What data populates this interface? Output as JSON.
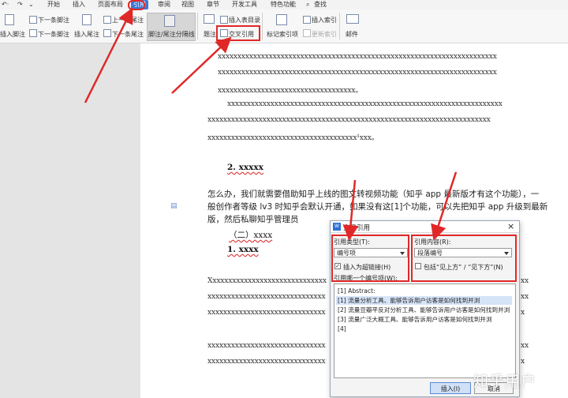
{
  "menubar": {
    "items": [
      "开始",
      "插入",
      "页面布局",
      "引用",
      "审阅",
      "视图",
      "章节",
      "开发工具",
      "特色功能"
    ],
    "search_label": "查找"
  },
  "ribbon": {
    "insert_footnote": "插入脚注",
    "next_footnote": "下一条脚注",
    "prev_footnote": "上一条脚注",
    "insert_endnote": "插入尾注",
    "prev_endnote": "上一条尾注",
    "next_endnote": "下一条尾注",
    "separator": "脚注/尾注分隔线",
    "caption": "题注",
    "insert_toc": "插入表目录",
    "cross_ref": "交叉引用",
    "mark_index": "标记索引项",
    "insert_index": "插入索引",
    "update_index": "更新索引",
    "mail": "邮件"
  },
  "document": {
    "para1": [
      "xxxxxxxxxxxxxxxxxxxxxxxxxxxxxxxxxxxxxxxxxxxxxxxxxxxxxxxxxxxxxxxxxxxxxxx",
      "xxxxxxxxxxxxxxxxxxxxxxxxxxxxxxxxxxxxxxxxxxxxxxxxxxxxxxxxxxxxxxxxxxxxxxx",
      "xxxxxxxxxxxxxxxxxxxxxxxxxxxxxxxxxxx。"
    ],
    "para2": [
      "xxxxxxxxxxxxxxxxxxxxxxxxxxxxxxxxxxxxxxxxxxxxxxxxxxxxxxxxxxxxxxxxxxxxxx",
      "xxxxxxxxxxxxxxxxxxxxxxxxxxxxxxxxxxxxxxxxxxxxxxxxxxxxxxxxxxxxxxxxxxxxxxxx",
      "xxxxxxxxxxxxxxxxxxxxxxxxxxxxxxxxxxxxxx¹xxx。"
    ],
    "heading2": "2. xxxxx",
    "zh_lines": [
      "怎么办，我们就需要借助知乎上线的图文转视频功能（知乎 app 最新版才有这个功能），一",
      "般创作者等级 lv3 时知乎会默认开通，如果没有这[1]个功能，可以先把知乎 app 升级到最新",
      "版，然后私聊知乎管理员"
    ],
    "subheading": "（二）xxxx",
    "heading1": "1. xxxx",
    "para3": [
      "Xxxxxxxxxxxxxxxxxxxxxxxxxxxxxx",
      "xxxxxxxxxxxxxxxxxxxxxxxxxxxxxx",
      "xxxxxxxxxxxxxxxxxxxxxxxxxxxxxx"
    ],
    "para4": [
      "xxxxxxxxxxxxxxxxxxxxxxxxxxxxxx",
      "xxxxxxxxxxxxxxxxxxxxxxxxxxxxxx"
    ],
    "right_tail": [
      "xx",
      "xx",
      "x",
      "xx",
      "x"
    ]
  },
  "dialog": {
    "title": "交叉引用",
    "ref_type_label": "引用类型(T):",
    "ref_type_value": "编号项",
    "ref_content_label": "引用内容(R):",
    "ref_content_value": "段落编号",
    "hyperlink_label": "插入为超链接(H)",
    "hyperlink_checked": true,
    "include_label": "包括“见上方” / “见下方”(N)",
    "include_checked": false,
    "list_label": "引用哪一个编号项(W):",
    "items": [
      "[1] Abstract:",
      "[1] 流量分析工具、能够告诉用户访客是如何找到并浏",
      "[2] 流量豆瓣平反对分析工具、能够告诉用户访客是如何找到并浏",
      "[3] 流量广泛大概工具、能够告诉用户访客是如何找到并浏",
      "[4]"
    ],
    "selected_index": 1,
    "insert_button": "插入(I)",
    "cancel_button": "取消"
  },
  "watermark": "知乎用户",
  "colors": {
    "accent": "#3b78d8",
    "annotation_red": "#e02828"
  }
}
